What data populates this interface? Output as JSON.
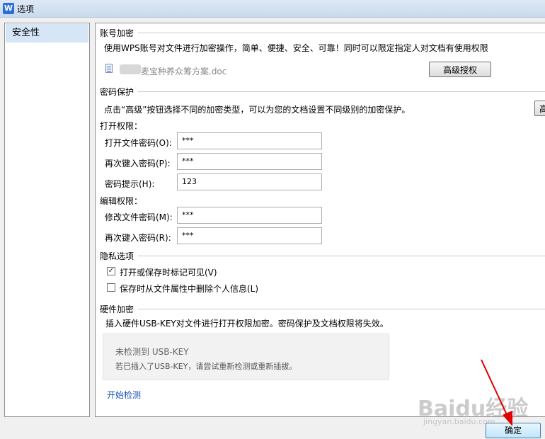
{
  "window": {
    "title": "选项"
  },
  "sidebar": {
    "items": [
      {
        "label": "安全性"
      }
    ]
  },
  "account": {
    "title": "账号加密",
    "desc": "使用WPS账号对文件进行加密操作，简单、便捷、安全、可靠！同时可以限定指定人对文档有使用权限",
    "file_name": "麦宝种养众筹方案.doc",
    "advanced_auth_label": "高级授权"
  },
  "password": {
    "title": "密码保护",
    "desc": "点击“高级”按钮选择不同的加密类型，可以为您的文档设置不同级别的加密保护。",
    "advanced_label": "高",
    "open_group": "打开权限：",
    "open_label": "打开文件密码(O):",
    "open_value": "***",
    "reenter_label": "再次键入密码(P):",
    "reenter_value": "***",
    "hint_label": "密码提示(H):",
    "hint_value": "123",
    "edit_group": "编辑权限：",
    "modify_label": "修改文件密码(M):",
    "modify_value": "***",
    "reenter2_label": "再次键入密码(R):",
    "reenter2_value": "***"
  },
  "privacy": {
    "title": "隐私选项",
    "option1": "打开或保存时标记可见(V)",
    "option1_checked": true,
    "option2": "保存时从文件属性中删除个人信息(L)",
    "option2_checked": false
  },
  "hardware": {
    "title": "硬件加密",
    "desc": "插入硬件USB-KEY对文件进行打开权限加密。密码保护及文档权限将失效。",
    "status": "未检测到 USB-KEY",
    "status_hint": "若已插入了USB-KEY，请尝试重新检测或重新插拔。",
    "detect_label": "开始检测"
  },
  "footer": {
    "ok_label": "确定"
  },
  "watermark": {
    "text": "Baidu经验",
    "sub": "jingyan.baidu.com"
  },
  "colors": {
    "accent": "#2a6fd6",
    "link": "#1a4fb3",
    "arrow": "#e00000"
  }
}
